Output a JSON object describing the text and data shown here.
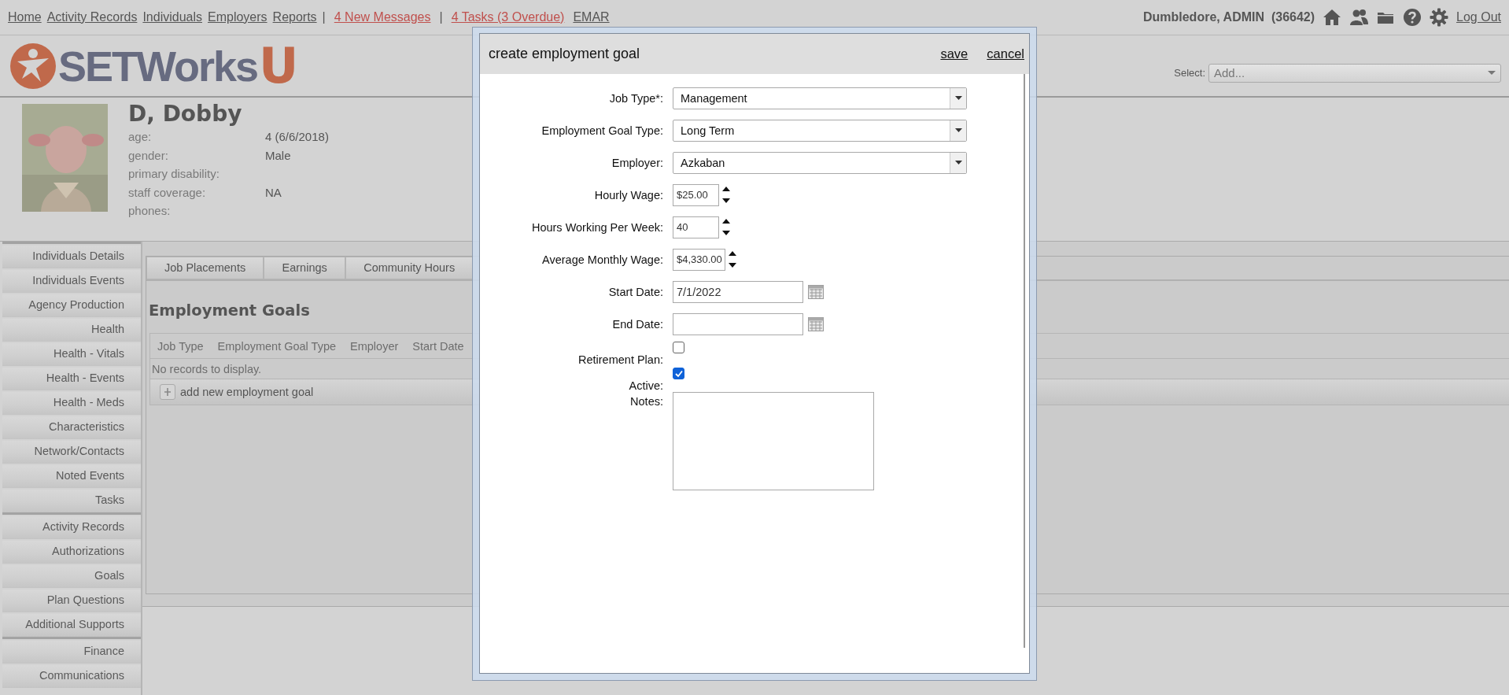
{
  "top_nav": {
    "links": [
      {
        "label": "Home",
        "kind": "plain"
      },
      {
        "label": "Activity Records",
        "kind": "plain"
      },
      {
        "label": "Individuals",
        "kind": "plain"
      },
      {
        "label": "Employers",
        "kind": "plain"
      },
      {
        "label": "Reports",
        "kind": "plain"
      },
      {
        "label": "|",
        "kind": "separator"
      },
      {
        "label": "4 New Messages",
        "kind": "alert"
      },
      {
        "label": "|",
        "kind": "separator"
      },
      {
        "label": "4 Tasks (3 Overdue)",
        "kind": "alert"
      },
      {
        "label": "EMAR",
        "kind": "plain"
      }
    ],
    "user": "Dumbledore, ADMIN  (36642)",
    "logout": "Log Out"
  },
  "logo": {
    "text": "SETWorks",
    "badge": "U"
  },
  "quick_select": {
    "label": "Select:",
    "placeholder": "Add..."
  },
  "profile": {
    "name": "D, Dobby",
    "fields": [
      {
        "label": "age:",
        "value": "4 (6/6/2018)"
      },
      {
        "label": "gender:",
        "value": "Male"
      },
      {
        "label": "primary disability:"
      },
      {
        "label": "staff coverage:",
        "value": "NA"
      },
      {
        "label": "phones:"
      }
    ]
  },
  "sidebar": {
    "groups": [
      {
        "items": [
          "Individuals Details",
          "Individuals Events",
          "Agency Production",
          "Health",
          "Health - Vitals",
          "Health - Events",
          "Health - Meds",
          "Characteristics",
          "Network/Contacts",
          "Noted Events",
          "Tasks"
        ]
      },
      {
        "items": [
          "Activity Records",
          "Authorizations",
          "Goals",
          "Plan Questions",
          "Additional Supports"
        ]
      },
      {
        "items": [
          "Finance",
          "Communications"
        ]
      }
    ]
  },
  "content": {
    "tabs": [
      {
        "label": "Job Placements",
        "selected": false
      },
      {
        "label": "Earnings",
        "selected": false
      },
      {
        "label": "Community Hours",
        "selected": false
      }
    ],
    "heading": "Employment Goals",
    "table": {
      "columns": [
        "Job Type",
        "Employment Goal Type",
        "Employer",
        "Start Date"
      ],
      "empty_text": "No records to display.",
      "add_label": "add new employment goal"
    }
  },
  "dialog": {
    "title": "create employment goal",
    "actions": [
      "save",
      "cancel"
    ],
    "fields": [
      {
        "label": "Job Type*:",
        "kind": "select",
        "value": "Management"
      },
      {
        "label": "Employment Goal Type:",
        "kind": "select",
        "value": "Long Term"
      },
      {
        "label": "Employer:",
        "kind": "select",
        "value": "Azkaban"
      },
      {
        "label": "Hourly Wage:",
        "kind": "number",
        "value": "$25.00"
      },
      {
        "label": "Hours Working Per Week:",
        "kind": "number",
        "value": "40"
      },
      {
        "label": "Average Monthly Wage:",
        "kind": "number",
        "value": "$4,330.00"
      },
      {
        "label": "Start Date:",
        "kind": "date",
        "value": "7/1/2022"
      },
      {
        "label": "End Date:",
        "kind": "date"
      },
      {
        "label": "Retirement Plan:",
        "kind": "checkbox",
        "checked": false
      },
      {
        "label": "Active:",
        "kind": "checkbox",
        "checked": true
      },
      {
        "label": "Notes:",
        "kind": "textarea"
      }
    ]
  }
}
